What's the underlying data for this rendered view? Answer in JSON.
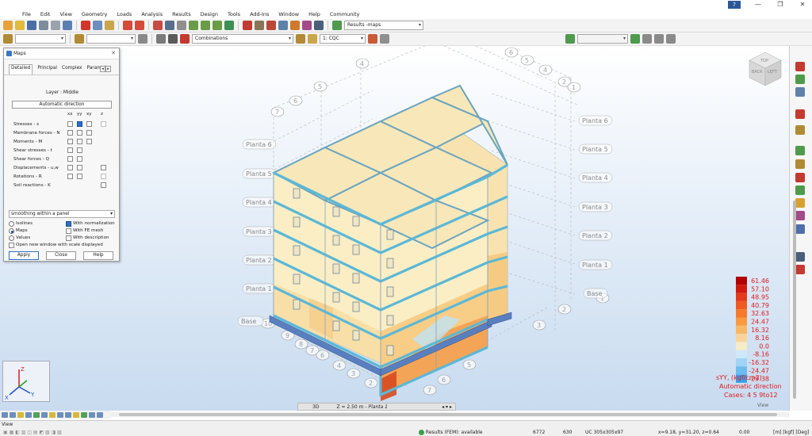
{
  "window": {
    "help_badge": "?",
    "minimize": "—",
    "restore": "❐",
    "close": "✕"
  },
  "menu": [
    "File",
    "Edit",
    "View",
    "Geometry",
    "Loads",
    "Analysis",
    "Results",
    "Design",
    "Tools",
    "Add-Ins",
    "Window",
    "Help",
    "Community"
  ],
  "toolbar": {
    "results_combo": "Results -maps",
    "combinations_combo": "Combinations",
    "case_combo": "1: CQC"
  },
  "maps_panel": {
    "title": "Maps",
    "tabs": [
      "Detailed",
      "Principal",
      "Complex",
      "Parameter"
    ],
    "active_tab": "Detailed",
    "layer": "Layer : Middle",
    "auto_direction": "Automatic direction",
    "columns": [
      "xx",
      "yy",
      "xy",
      "z"
    ],
    "rows": [
      {
        "label": "Stresses - s"
      },
      {
        "label": "Membrane forces - N"
      },
      {
        "label": "Moments - M"
      },
      {
        "label": "Shear stresses - t"
      },
      {
        "label": "Shear forces - Q"
      },
      {
        "label": "Displacements - u,w"
      },
      {
        "label": "Rotations - R"
      },
      {
        "label": "Soil reactions - K"
      }
    ],
    "smoothing": "smoothing within a panel",
    "display_modes": [
      "Isolines",
      "Maps",
      "Values"
    ],
    "selected_mode": "Maps",
    "options": [
      "With normalization",
      "With FE mesh",
      "With description"
    ],
    "new_window": "Open new window with scale displayed",
    "buttons": {
      "apply": "Apply",
      "close": "Close",
      "help": "Help"
    }
  },
  "view": {
    "levels_left": [
      "Planta 6",
      "Planta 5",
      "Planta 4",
      "Planta 3",
      "Planta 2",
      "Planta 1",
      "Base"
    ],
    "levels_right": [
      "Planta 6",
      "Planta 5",
      "Planta 4",
      "Planta 3",
      "Planta 2",
      "Planta 1",
      "Base"
    ],
    "grid_numbers": [
      "1",
      "2",
      "3",
      "4",
      "5",
      "6",
      "7",
      "8",
      "9",
      "10",
      "11"
    ],
    "cube_labels": {
      "top": "TOP",
      "left": "BACK",
      "right": "LEFT"
    },
    "bottom_mode": "3D",
    "bottom_level": "Z = 2.50 m - ",
    "bottom_level_name": "Planta 1",
    "view_label": "View",
    "axis_x": "X",
    "axis_y": "Y",
    "axis_z": "Z"
  },
  "legend": {
    "values": [
      "61.46",
      "57.10",
      "48.95",
      "40.79",
      "32.63",
      "24.47",
      "16.32",
      "8.16",
      "0.0",
      "-8.16",
      "-16.32",
      "-24.47",
      "-29.38"
    ],
    "colors": [
      "#b30000",
      "#d11a0f",
      "#e6391a",
      "#f05a22",
      "#f57a2c",
      "#f89a3d",
      "#f9b866",
      "#f9d49a",
      "#f7ecc6",
      "#cfe8f7",
      "#9fd4f4",
      "#6cbcf0",
      "#3d9fe8"
    ],
    "caption": [
      "sYY, (kgf/cm2)",
      "Automatic direction",
      "Cases: 4 5 9to12"
    ]
  },
  "status": {
    "view": "View",
    "results": "Results (FEM): available",
    "nodes": "6772",
    "elements": "630",
    "section": "UC 305x305x97",
    "coords": "x=9.18, y=31.20, z=0.64",
    "value": "0.00",
    "units": "[m] [kgf] [Deg]"
  }
}
